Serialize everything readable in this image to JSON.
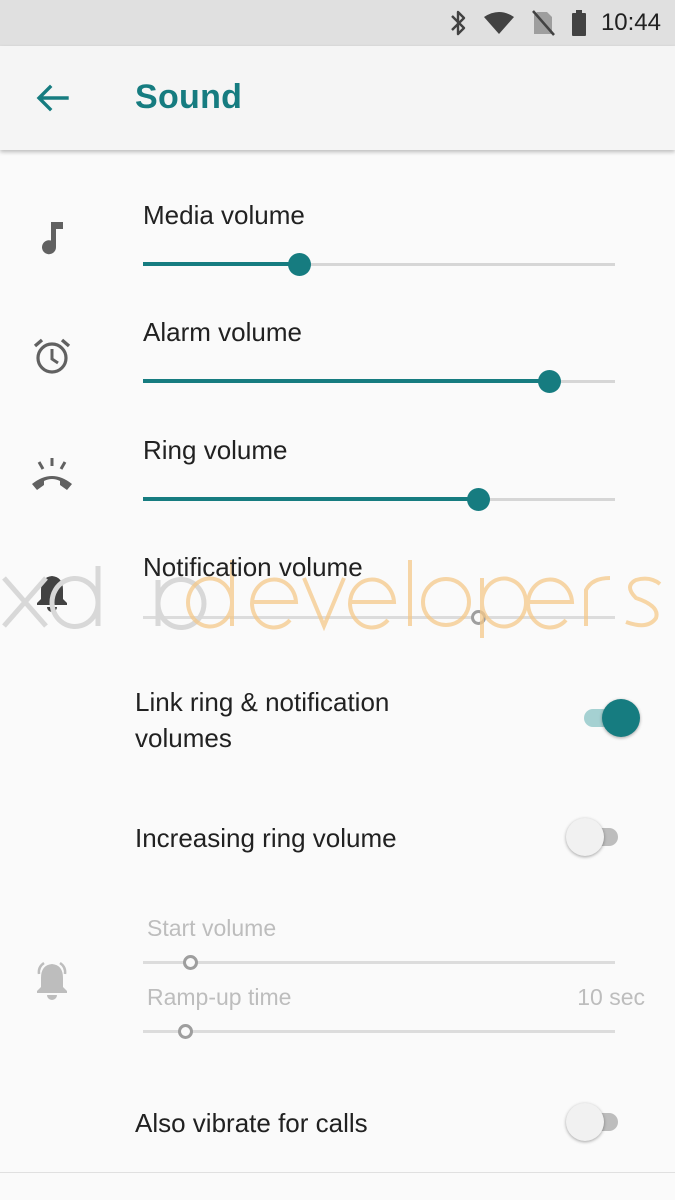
{
  "status_bar": {
    "time": "10:44",
    "icons": [
      "bluetooth-icon",
      "wifi-icon",
      "no-sim-icon",
      "battery-icon"
    ]
  },
  "app_bar": {
    "back_icon": "arrow-back-icon",
    "title": "Sound"
  },
  "volumes": [
    {
      "label": "Media volume",
      "icon": "music-note-icon",
      "level": 0.33,
      "enabled": true
    },
    {
      "label": "Alarm volume",
      "icon": "alarm-clock-icon",
      "level": 0.86,
      "enabled": true
    },
    {
      "label": "Ring volume",
      "icon": "ringing-phone-icon",
      "level": 0.71,
      "enabled": true
    },
    {
      "label": "Notification volume",
      "icon": "bell-icon",
      "level": 0.71,
      "enabled": false
    }
  ],
  "link_ring": {
    "title": "Link ring & notification volumes",
    "line1": "Link ring & notification",
    "line2": "volumes",
    "on": true
  },
  "increasing_ring": {
    "title": "Increasing ring volume",
    "on": false
  },
  "start_volume": {
    "label": "Start volume",
    "level": 0.1
  },
  "ramp_up": {
    "label": "Ramp-up time",
    "value": "10 sec",
    "level": 0.09
  },
  "also_vibrate": {
    "title": "Also vibrate for calls",
    "on": false
  },
  "watermark": {
    "part1": "xda",
    "part2": "developers"
  },
  "colors": {
    "accent": "#167c80",
    "accent_light": "#a5d1d2",
    "watermark_orange": "#f5c98a"
  }
}
